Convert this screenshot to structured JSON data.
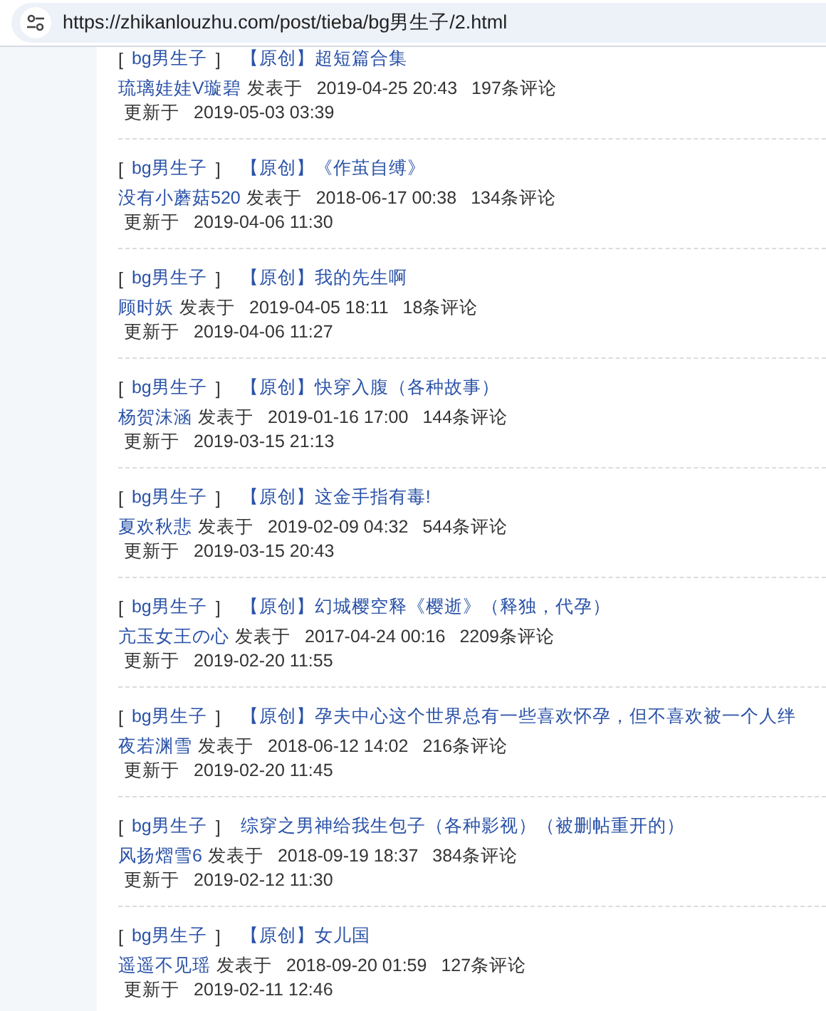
{
  "address_bar": {
    "url": "https://zhikanlouzhu.com/post/tieba/bg男生子/2.html"
  },
  "posts": [
    {
      "board_open": "[",
      "board": "bg男生子",
      "board_close": "]",
      "title": "【原创】超短篇合集",
      "author": "琉璃娃娃V璇碧",
      "posted_label": "发表于",
      "posted": "2019-04-25 20:43",
      "comments": "197条评论",
      "updated_label": "更新于",
      "updated": "2019-05-03 03:39"
    },
    {
      "board_open": "[",
      "board": "bg男生子",
      "board_close": "]",
      "title": "【原创】《作茧自缚》",
      "author": "没有小蘑菇520",
      "posted_label": "发表于",
      "posted": "2018-06-17 00:38",
      "comments": "134条评论",
      "updated_label": "更新于",
      "updated": "2019-04-06 11:30"
    },
    {
      "board_open": "[",
      "board": "bg男生子",
      "board_close": "]",
      "title": "【原创】我的先生啊",
      "author": "顾时妖",
      "posted_label": "发表于",
      "posted": "2019-04-05 18:11",
      "comments": "18条评论",
      "updated_label": "更新于",
      "updated": "2019-04-06 11:27"
    },
    {
      "board_open": "[",
      "board": "bg男生子",
      "board_close": "]",
      "title": "【原创】快穿入腹（各种故事）",
      "author": "杨贺沫涵",
      "posted_label": "发表于",
      "posted": "2019-01-16 17:00",
      "comments": "144条评论",
      "updated_label": "更新于",
      "updated": "2019-03-15 21:13"
    },
    {
      "board_open": "[",
      "board": "bg男生子",
      "board_close": "]",
      "title": "【原创】这金手指有毒!",
      "author": "夏欢秋悲",
      "posted_label": "发表于",
      "posted": "2019-02-09 04:32",
      "comments": "544条评论",
      "updated_label": "更新于",
      "updated": "2019-03-15 20:43"
    },
    {
      "board_open": "[",
      "board": "bg男生子",
      "board_close": "]",
      "title": "【原创】幻城樱空释《樱逝》（释独，代孕）",
      "author": "亢玉女王の心",
      "posted_label": "发表于",
      "posted": "2017-04-24 00:16",
      "comments": "2209条评论",
      "updated_label": "更新于",
      "updated": "2019-02-20 11:55"
    },
    {
      "board_open": "[",
      "board": "bg男生子",
      "board_close": "]",
      "title": "【原创】孕夫中心这个世界总有一些喜欢怀孕，但不喜欢被一个人绊",
      "author": "夜若渊雪",
      "posted_label": "发表于",
      "posted": "2018-06-12 14:02",
      "comments": "216条评论",
      "updated_label": "更新于",
      "updated": "2019-02-20 11:45"
    },
    {
      "board_open": "[",
      "board": "bg男生子",
      "board_close": "]",
      "title": "综穿之男神给我生包子（各种影视）（被删帖重开的）",
      "author": "风扬熠雪6",
      "posted_label": "发表于",
      "posted": "2018-09-19 18:37",
      "comments": "384条评论",
      "updated_label": "更新于",
      "updated": "2019-02-12 11:30"
    },
    {
      "board_open": "[",
      "board": "bg男生子",
      "board_close": "]",
      "title": "【原创】女儿国",
      "author": "遥遥不见瑶",
      "posted_label": "发表于",
      "posted": "2018-09-20 01:59",
      "comments": "127条评论",
      "updated_label": "更新于",
      "updated": "2019-02-11 12:46"
    }
  ]
}
